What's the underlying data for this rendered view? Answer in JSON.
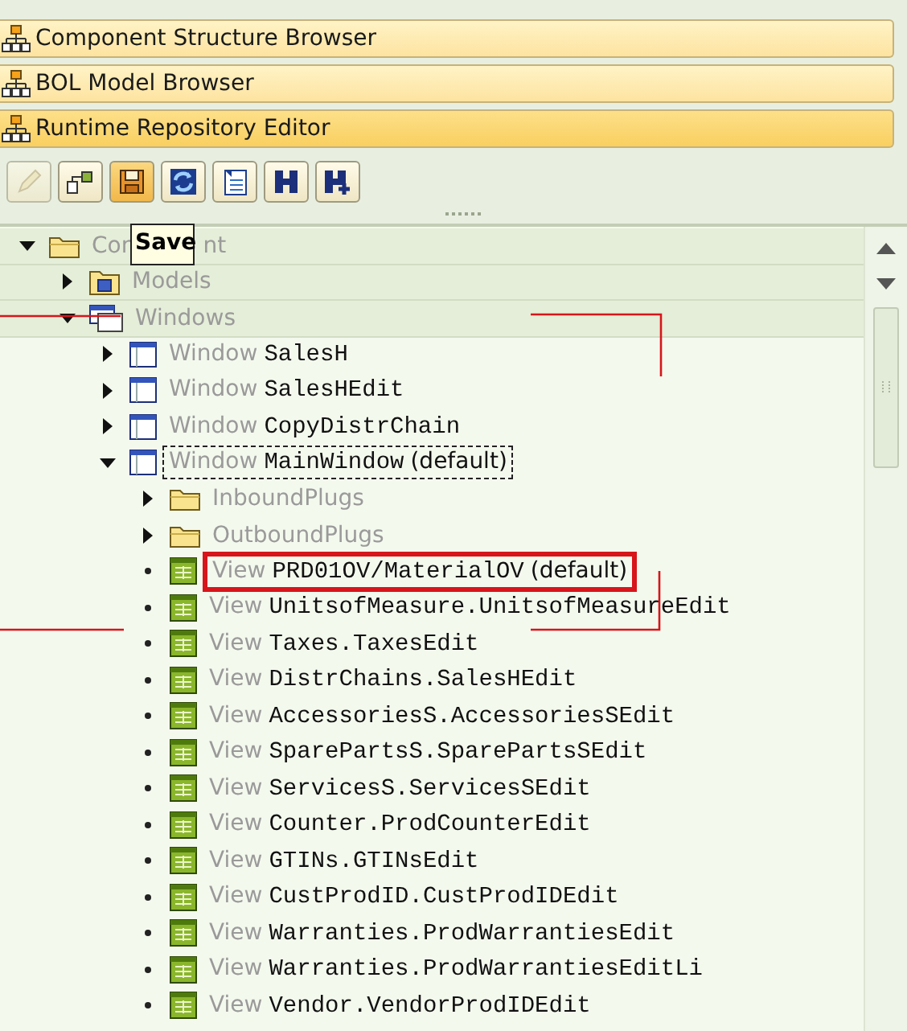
{
  "browsers": [
    {
      "label": "Component Structure Browser",
      "selected": false
    },
    {
      "label": "BOL Model Browser",
      "selected": false
    },
    {
      "label": "Runtime Repository Editor",
      "selected": true
    }
  ],
  "toolbar": [
    {
      "kind": "pencil",
      "disabled": true,
      "hovered": false
    },
    {
      "kind": "hierarchy",
      "disabled": false,
      "hovered": false
    },
    {
      "kind": "save",
      "disabled": false,
      "hovered": true
    },
    {
      "kind": "refresh",
      "disabled": false,
      "hovered": false
    },
    {
      "kind": "document",
      "disabled": false,
      "hovered": false
    },
    {
      "kind": "find",
      "disabled": false,
      "hovered": false
    },
    {
      "kind": "find-next",
      "disabled": false,
      "hovered": false
    }
  ],
  "tooltip": "Save",
  "tree": [
    {
      "kind": "component",
      "prefix": "Con",
      "prefix_tail": "nt",
      "expanded": true,
      "children": [
        {
          "kind": "models",
          "prefix": "Models",
          "expanded": false
        },
        {
          "kind": "windows",
          "prefix": "Windows",
          "expanded": true,
          "children": [
            {
              "kind": "window",
              "prefix": "Window",
              "name": "SalesH",
              "expanded": false
            },
            {
              "kind": "window",
              "prefix": "Window",
              "name": "SalesHEdit",
              "expanded": false
            },
            {
              "kind": "window",
              "prefix": "Window",
              "name": "CopyDistrChain",
              "expanded": false
            },
            {
              "kind": "window",
              "prefix": "Window",
              "name": "MainWindow",
              "suffix": "(default)",
              "expanded": true,
              "focused": true,
              "children": [
                {
                  "kind": "folder",
                  "prefix": "InboundPlugs",
                  "expanded": false
                },
                {
                  "kind": "folder",
                  "prefix": "OutboundPlugs",
                  "expanded": false
                },
                {
                  "kind": "view",
                  "prefix": "View",
                  "name": "PRD01OV/MaterialOV",
                  "suffix": "(default)",
                  "highlighted": true
                },
                {
                  "kind": "view",
                  "prefix": "View",
                  "name": "UnitsofMeasure.UnitsofMeasureEdit"
                },
                {
                  "kind": "view",
                  "prefix": "View",
                  "name": "Taxes.TaxesEdit"
                },
                {
                  "kind": "view",
                  "prefix": "View",
                  "name": "DistrChains.SalesHEdit"
                },
                {
                  "kind": "view",
                  "prefix": "View",
                  "name": "AccessoriesS.AccessoriesSEdit"
                },
                {
                  "kind": "view",
                  "prefix": "View",
                  "name": "SparePartsS.SparePartsSEdit"
                },
                {
                  "kind": "view",
                  "prefix": "View",
                  "name": "ServicesS.ServicesSEdit"
                },
                {
                  "kind": "view",
                  "prefix": "View",
                  "name": "Counter.ProdCounterEdit"
                },
                {
                  "kind": "view",
                  "prefix": "View",
                  "name": "GTINs.GTINsEdit"
                },
                {
                  "kind": "view",
                  "prefix": "View",
                  "name": "CustProdID.CustProdIDEdit"
                },
                {
                  "kind": "view",
                  "prefix": "View",
                  "name": "Warranties.ProdWarrantiesEdit"
                },
                {
                  "kind": "view",
                  "prefix": "View",
                  "name": "Warranties.ProdWarrantiesEditLi"
                },
                {
                  "kind": "view",
                  "prefix": "View",
                  "name": "Vendor.VendorProdIDEdit"
                }
              ]
            }
          ]
        }
      ]
    }
  ]
}
